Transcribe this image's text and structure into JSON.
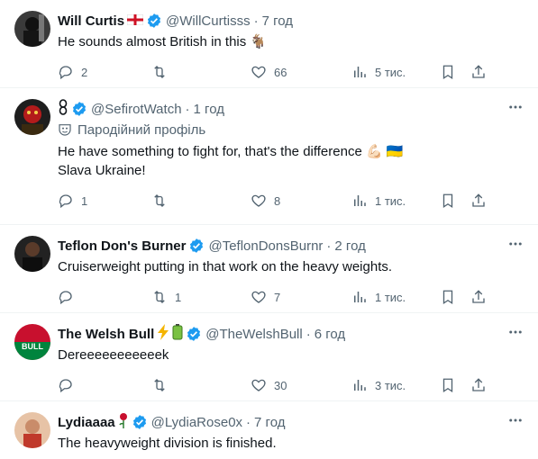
{
  "tweets": [
    {
      "name": "Will Curtis",
      "name_emoji": "england-flag",
      "handle": "@WillCurtisss",
      "time": "7 год",
      "text": "He sounds almost British in this 🐐",
      "replies": "2",
      "retweets": "",
      "likes": "66",
      "views": "5 тис.",
      "avatar_color": "#2b2b2b"
    },
    {
      "name": "",
      "name_emoji": "chain-symbol",
      "handle": "@SefirotWatch",
      "time": "1 год",
      "parody_label": "Пародійний профіль",
      "text": "He have something to fight for, that's the difference 💪🏻 🇺🇦\nSlava Ukraine!",
      "replies": "1",
      "retweets": "",
      "likes": "8",
      "views": "1 тис.",
      "avatar_color": "#1a1a1a"
    },
    {
      "name": "Teflon Don's Burner",
      "handle": "@TeflonDonsBurnr",
      "time": "2 год",
      "text": "Cruiserweight putting in that work on the heavy weights.",
      "replies": "",
      "retweets": "1",
      "likes": "7",
      "views": "1 тис.",
      "avatar_color": "#1c1c1c"
    },
    {
      "name": "The Welsh Bull",
      "name_emoji": "lightning-battery",
      "handle": "@TheWelshBull",
      "time": "6 год",
      "text": "Dereeeeeeeeeeek",
      "replies": "",
      "retweets": "",
      "likes": "30",
      "views": "3 тис.",
      "avatar_color": "#c8102e"
    },
    {
      "name": "Lydiaaaa",
      "name_emoji": "rose",
      "handle": "@LydiaRose0x",
      "time": "7 год",
      "text": "The heavyweight division is finished.",
      "replies": "",
      "retweets": "",
      "likes": "",
      "views": "",
      "avatar_color": "#d9a98a"
    }
  ],
  "colors": {
    "verified": "#1d9bf0",
    "muted": "#536471",
    "text": "#0f1419"
  }
}
